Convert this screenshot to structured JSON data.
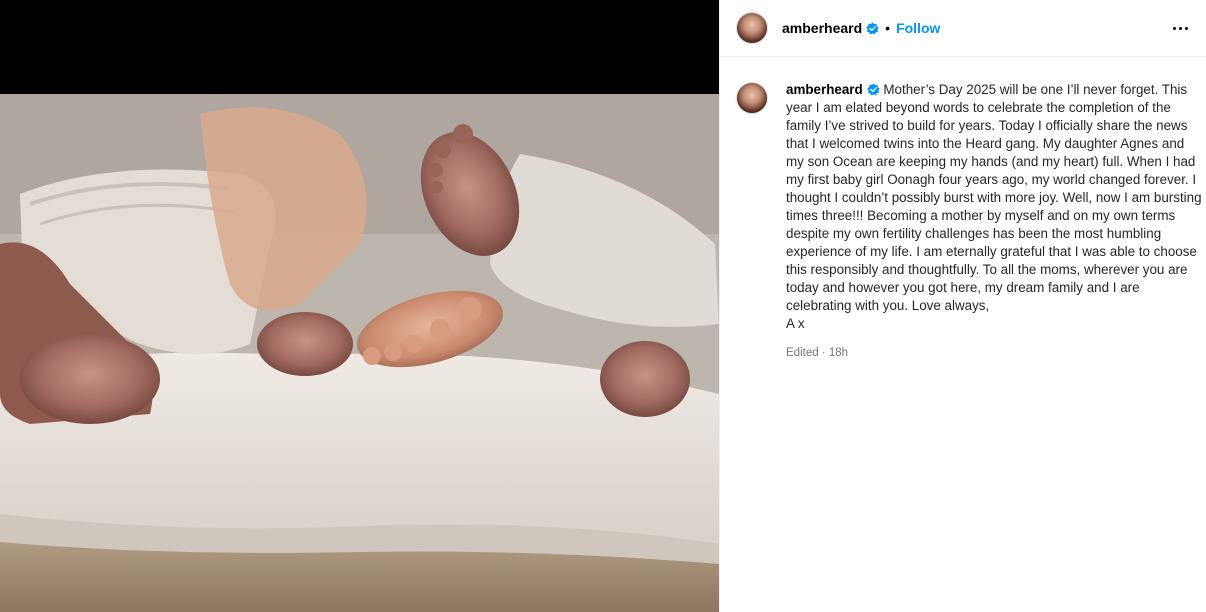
{
  "post": {
    "media_alt": "",
    "author": {
      "username": "amberheard",
      "verified_icon": "verified-badge-icon",
      "follow_label": "Follow",
      "separator": "•"
    },
    "caption": {
      "username": "amberheard",
      "text": "Mother’s Day 2025 will be one I’ll never forget. This year I am elated beyond words to celebrate the completion of the family I’ve strived to build for years. Today I officially share the news that I welcomed twins into the Heard gang. My daughter Agnes and my son Ocean are keeping my hands (and my heart) full. When I had my first baby girl Oonagh four years ago, my world changed forever. I thought I couldn’t possibly burst with more joy. Well, now I am bursting times three!!! Becoming a mother by myself and on my own terms despite my own fertility challenges has been the most humbling experience of my life. I am eternally grateful that I was able to choose this responsibly and thoughtfully. To all the moms, wherever you are today and however you got here, my dream family and I are celebrating with you. Love always,\nA x",
      "meta": "Edited · 18h"
    },
    "colors": {
      "link": "#0095f6",
      "verified": "#0095f6",
      "muted": "#737373",
      "divider": "#efefef"
    }
  }
}
